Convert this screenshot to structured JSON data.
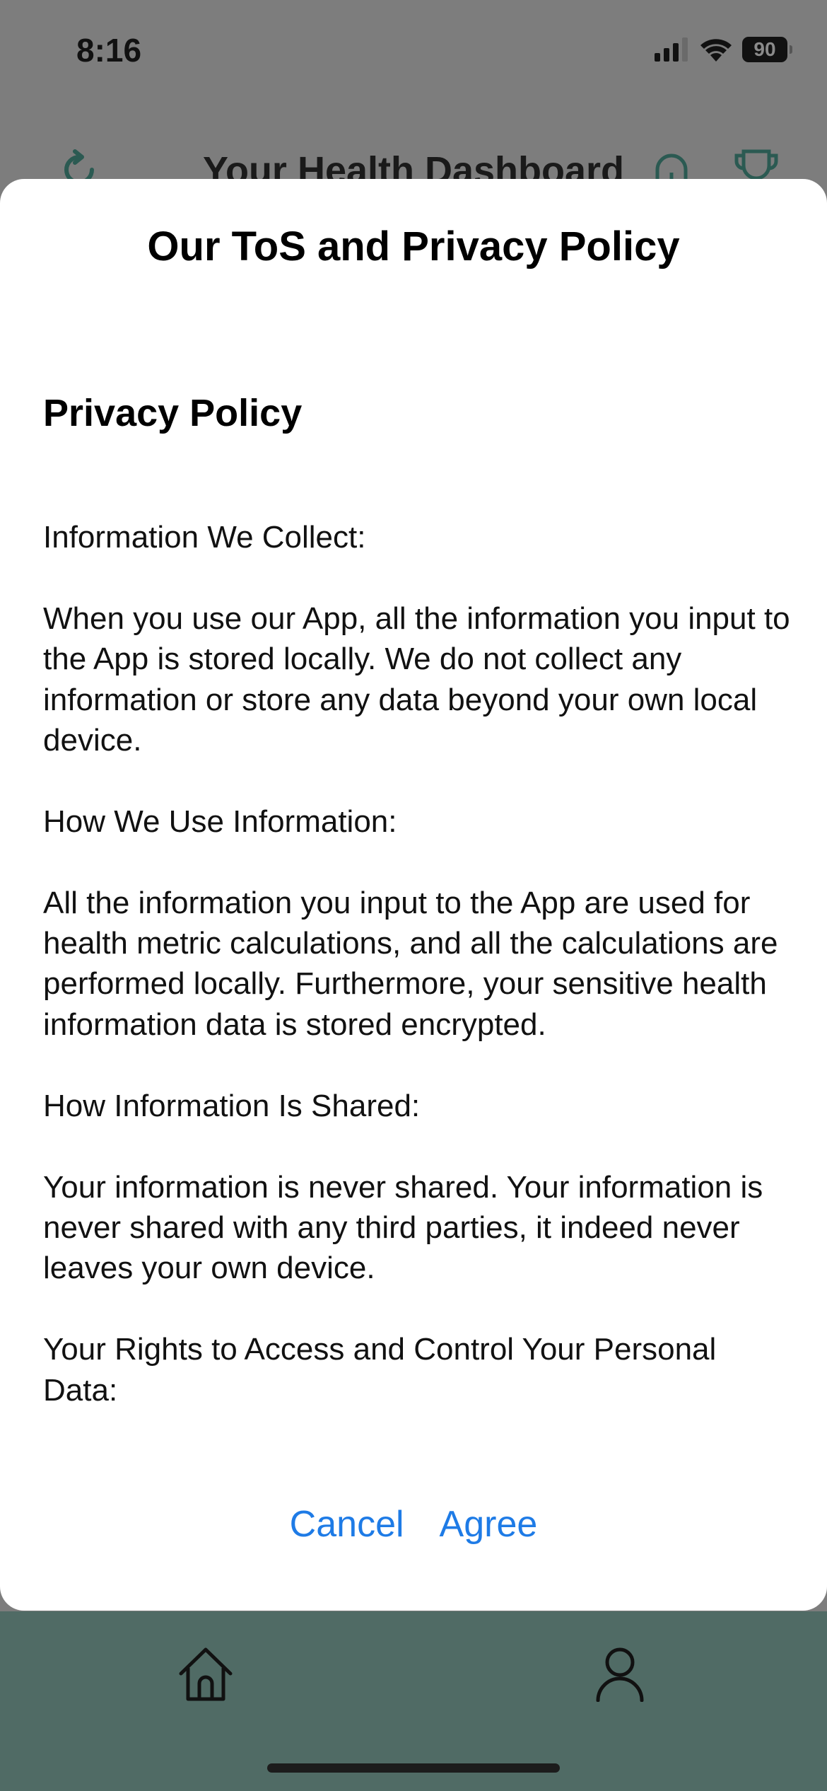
{
  "status_bar": {
    "time": "8:16",
    "battery": "90"
  },
  "app": {
    "header_title": "Your Health Dashboard"
  },
  "modal": {
    "title": "Our ToS and Privacy Policy",
    "heading": "Privacy Policy",
    "body": "Information We Collect:\n\nWhen you use our App, all the information you input to the App is stored locally. We do not collect any information or store any data beyond your own local device.\n\nHow We Use Information:\n\nAll the information you input to the App are used for health metric calculations, and all the calculations are performed locally. Furthermore, your sensitive health information data is stored encrypted.\n\nHow Information Is Shared:\n\nYour information is never shared. Your information is never shared with any third parties, it indeed never leaves your own device.\n\nYour Rights to Access and Control Your Personal Data:",
    "cancel_label": "Cancel",
    "agree_label": "Agree"
  },
  "tab_bar": {
    "items": [
      "home-icon",
      "person-icon"
    ]
  },
  "colors": {
    "accent": "#1e7be6",
    "tab_bar": "#506b65",
    "overlay": "#7d7d7d"
  }
}
